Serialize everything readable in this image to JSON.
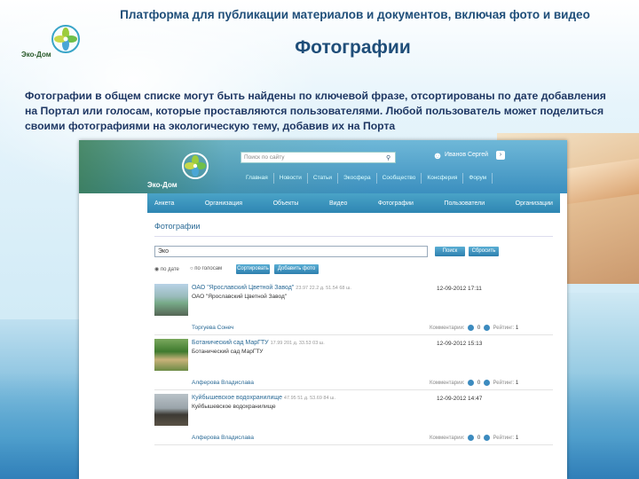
{
  "slide": {
    "title": "Платформа для публикации материалов и документов, включая фото и видео",
    "subtitle": "Фотографии",
    "description": "Фотографии в общем списке могут быть найдены по ключевой фразе, отсортированы по дате добавления на Портал или голосам, которые проставляются пользователями. Любой пользователь может поделиться своими фотографиями на экологическую тему, добавив их на Порта",
    "logo_text": "Эко-Дом"
  },
  "site": {
    "logo_text": "Эко-Дом",
    "search_placeholder": "Поиск по сайту",
    "user_name": "Иванов Сергей",
    "top_nav": [
      "Главная",
      "Новости",
      "Статьи",
      "Экосфера",
      "Сообщество",
      "Консферия",
      "Форум"
    ],
    "menu": [
      "Анкета",
      "Организация",
      "Объекты",
      "Видео",
      "Фотографии",
      "Пользователи",
      "Организации"
    ],
    "page_heading": "Фотографии",
    "query": "Эко",
    "find_button": "Поиск",
    "reset_button": "Сбросить",
    "radio_date": "по дате",
    "radio_votes": "по голосам",
    "sort_button": "Сортировать",
    "add_button": "Добавить фото",
    "comments_label": "Комментарии:",
    "rating_label": "Рейтинг:",
    "photos": [
      {
        "title": "ОАО \"Ярославский Цветной Завод\"",
        "meta": "23.97 22.2 д. 51.54 68 ш.",
        "org": "ОАО \"Ярославский Цветной Завод\"",
        "date": "12-09-2012 17:11",
        "author": "Торгуева Сонеч",
        "comments": "0",
        "rating": "1"
      },
      {
        "title": "Ботанический сад МарГТУ",
        "meta": "17.99 201 д. 33.53 03 ш.",
        "org": "Ботанический сад МарГТУ",
        "date": "12-09-2012 15:13",
        "author": "Алферова Владислава",
        "comments": "0",
        "rating": "1"
      },
      {
        "title": "Куйбышевское водохранилище",
        "meta": "47.95 51 д. 53.69 84 ш.",
        "org": "Куйбышевское водохранилище",
        "date": "12-09-2012 14:47",
        "author": "Алферова Владислава",
        "comments": "0",
        "rating": "1"
      }
    ]
  },
  "colors": {
    "heading": "#1f4e79",
    "accent": "#2e86b3"
  }
}
